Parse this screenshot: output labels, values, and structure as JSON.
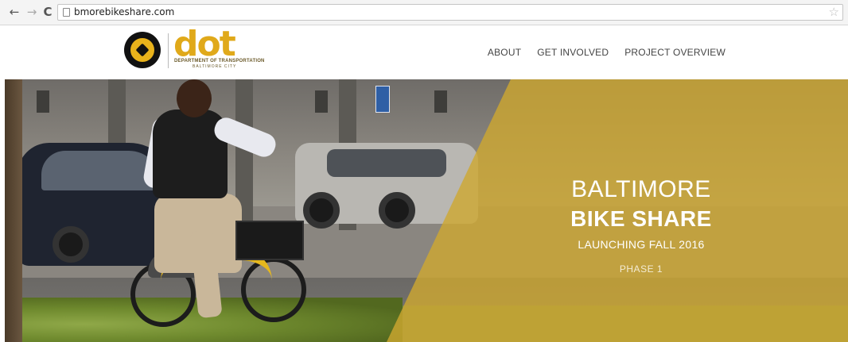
{
  "browser": {
    "url": "bmorebikeshare.com"
  },
  "header": {
    "logo_text": "dot",
    "logo_subtitle": "DEPARTMENT OF TRANSPORTATION",
    "logo_city": "BALTIMORE CITY",
    "nav": [
      "ABOUT",
      "GET INVOLVED",
      "PROJECT OVERVIEW"
    ]
  },
  "hero": {
    "line1": "BALTIMORE",
    "line2": "BIKE SHARE",
    "line3": "LAUNCHING FALL 2016",
    "line4": "PHASE 1",
    "overlay_color": "#cea830"
  }
}
